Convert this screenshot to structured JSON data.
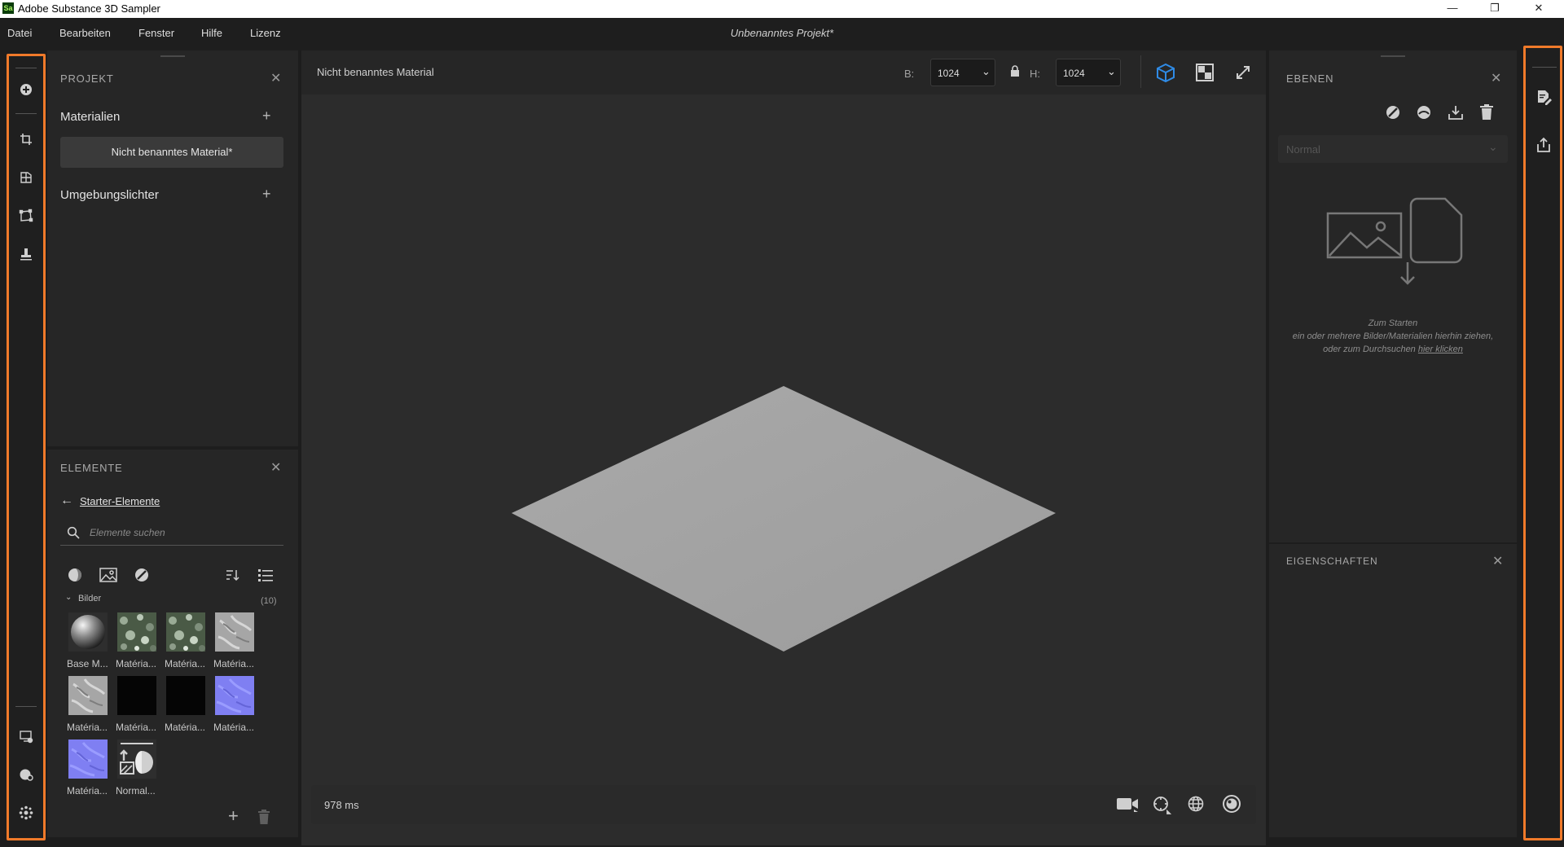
{
  "window": {
    "title": "Adobe Substance 3D Sampler",
    "logo_text": "Sa",
    "minimize": "—",
    "restore": "❐",
    "close": "✕"
  },
  "menu": {
    "items": [
      "Datei",
      "Bearbeiten",
      "Fenster",
      "Hilfe",
      "Lizenz"
    ],
    "project_title": "Unbenanntes Projekt*"
  },
  "left_toolbar": {
    "icons": [
      "add-icon",
      "crop-icon",
      "tiling-icon",
      "transform-icon",
      "stamp-icon",
      "display-settings-icon",
      "environment-icon",
      "plugins-icon"
    ]
  },
  "project_panel": {
    "title": "PROJEKT",
    "materials_label": "Materialien",
    "material_item": "Nicht benanntes Material*",
    "lights_label": "Umgebungslichter"
  },
  "elements_panel": {
    "title": "ELEMENTE",
    "back_label": "Starter-Elemente",
    "search_placeholder": "Elemente suchen",
    "group_label": "Bilder",
    "group_count": "(10)",
    "items": [
      {
        "label": "Base M...",
        "kind": "sphere"
      },
      {
        "label": "Matéria...",
        "kind": "moss"
      },
      {
        "label": "Matéria...",
        "kind": "moss"
      },
      {
        "label": "Matéria...",
        "kind": "gray"
      },
      {
        "label": "Matéria...",
        "kind": "gray"
      },
      {
        "label": "Matéria...",
        "kind": "black"
      },
      {
        "label": "Matéria...",
        "kind": "black"
      },
      {
        "label": "Matéria...",
        "kind": "normal"
      },
      {
        "label": "Matéria...",
        "kind": "normal"
      },
      {
        "label": "Normal...",
        "kind": "normal-tool"
      }
    ]
  },
  "viewport": {
    "material_name": "Nicht benanntes Material",
    "width_label": "B:",
    "width_value": "1024",
    "height_label": "H:",
    "height_value": "1024",
    "render_time": "978 ms"
  },
  "layers_panel": {
    "title": "EBENEN",
    "blend_mode": "Normal",
    "hint_title": "Zum Starten",
    "hint_line1": "ein oder mehrere Bilder/Materialien hierhin ziehen,",
    "hint_line2_prefix": "oder zum Durchsuchen",
    "hint_link": "hier klicken"
  },
  "properties_panel": {
    "title": "EIGENSCHAFTEN"
  },
  "colors": {
    "accent_orange": "#f07a2a",
    "accent_blue": "#2f8be6"
  }
}
